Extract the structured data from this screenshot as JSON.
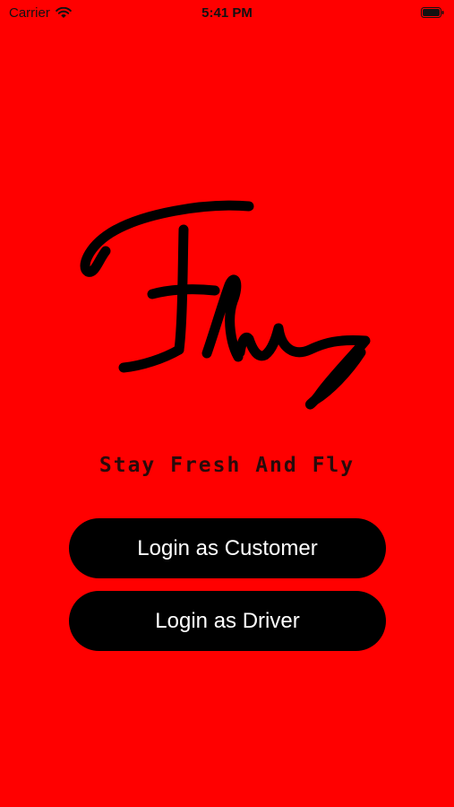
{
  "status_bar": {
    "carrier": "Carrier",
    "time": "5:41 PM",
    "icons": [
      "wifi-icon",
      "battery-icon"
    ]
  },
  "logo": {
    "text": "Fly"
  },
  "tagline": "Stay Fresh And Fly",
  "buttons": {
    "customer_label": "Login as Customer",
    "driver_label": "Login as Driver"
  },
  "colors": {
    "background": "#ff0000",
    "button_bg": "#000000",
    "button_text": "#ffffff"
  }
}
